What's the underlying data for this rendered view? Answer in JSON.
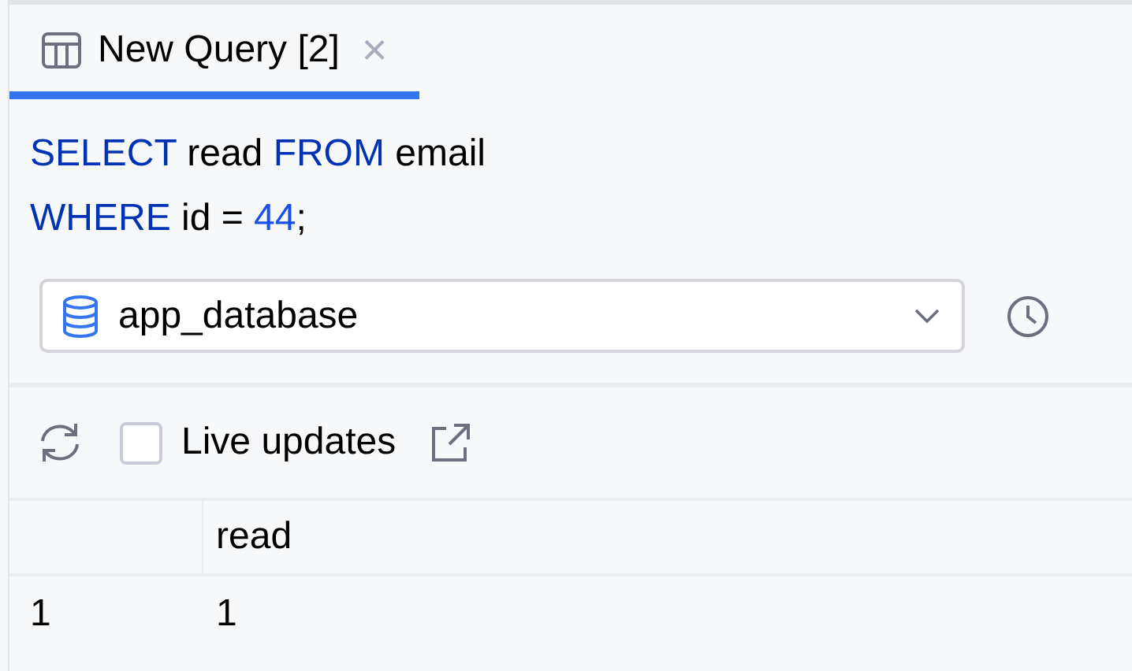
{
  "tab": {
    "title": "New Query [2]",
    "close": "×",
    "selected": true
  },
  "query_lines": [
    [
      {
        "kind": "keyword",
        "text": "SELECT"
      },
      {
        "kind": "plain",
        "text": " read "
      },
      {
        "kind": "keyword",
        "text": "FROM"
      },
      {
        "kind": "plain",
        "text": " email"
      }
    ],
    [
      {
        "kind": "keyword",
        "text": "WHERE"
      },
      {
        "kind": "plain",
        "text": " id = "
      },
      {
        "kind": "number",
        "text": "44"
      },
      {
        "kind": "plain",
        "text": ";"
      }
    ]
  ],
  "database_select": {
    "value": "app_database"
  },
  "results_toolbar": {
    "live_updates": {
      "label": "Live updates",
      "checked": false
    }
  },
  "table": {
    "columns": [
      "",
      "read"
    ],
    "rows": [
      [
        "1",
        "1"
      ]
    ]
  }
}
